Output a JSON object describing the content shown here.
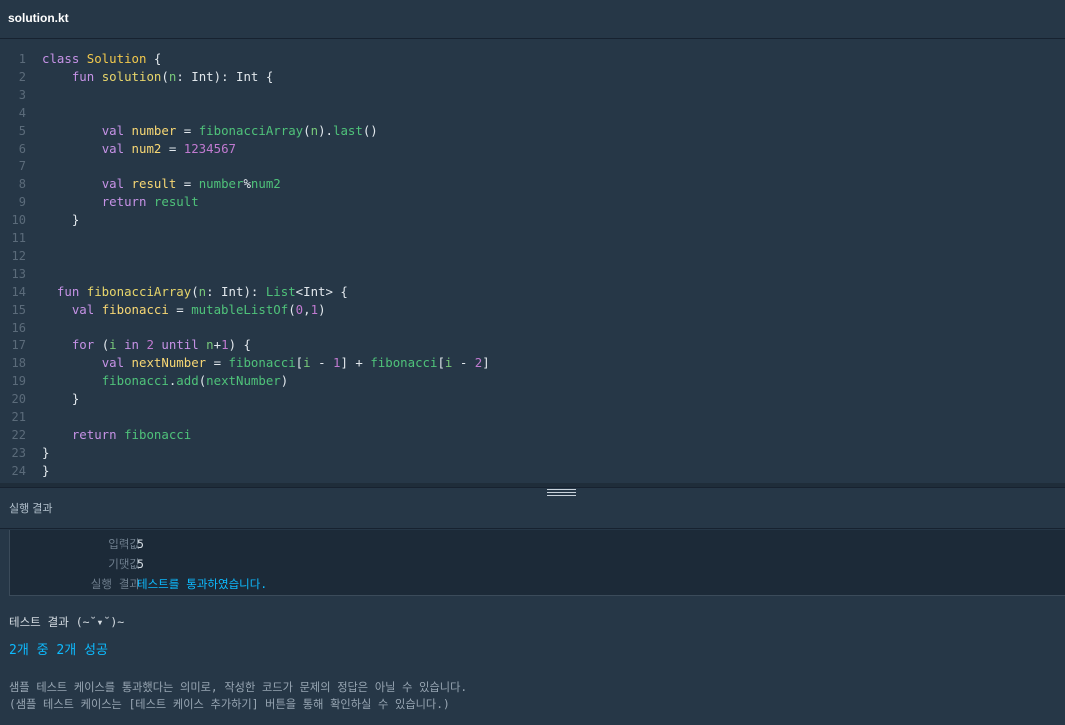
{
  "file": {
    "name": "solution.kt"
  },
  "editor": {
    "lines": [
      {
        "no": "1",
        "tokens": [
          [
            "kw",
            "class "
          ],
          [
            "cls",
            "Solution"
          ],
          [
            "plain",
            " {"
          ]
        ]
      },
      {
        "no": "2",
        "tokens": [
          [
            "plain",
            "    "
          ],
          [
            "kw",
            "fun "
          ],
          [
            "fn",
            "solution"
          ],
          [
            "plain",
            "("
          ],
          [
            "param",
            "n"
          ],
          [
            "plain",
            ": Int): Int {"
          ]
        ]
      },
      {
        "no": "3",
        "tokens": []
      },
      {
        "no": "4",
        "tokens": []
      },
      {
        "no": "5",
        "tokens": [
          [
            "plain",
            "        "
          ],
          [
            "kw",
            "val "
          ],
          [
            "var",
            "number"
          ],
          [
            "plain",
            " = "
          ],
          [
            "call",
            "fibonacciArray"
          ],
          [
            "plain",
            "("
          ],
          [
            "param",
            "n"
          ],
          [
            "plain",
            ")."
          ],
          [
            "call",
            "last"
          ],
          [
            "plain",
            "()"
          ]
        ]
      },
      {
        "no": "6",
        "tokens": [
          [
            "plain",
            "        "
          ],
          [
            "kw",
            "val "
          ],
          [
            "var",
            "num2"
          ],
          [
            "plain",
            " = "
          ],
          [
            "num",
            "1234567"
          ]
        ]
      },
      {
        "no": "7",
        "tokens": []
      },
      {
        "no": "8",
        "tokens": [
          [
            "plain",
            "        "
          ],
          [
            "kw",
            "val "
          ],
          [
            "var",
            "result"
          ],
          [
            "plain",
            " = "
          ],
          [
            "call",
            "number"
          ],
          [
            "plain",
            "%"
          ],
          [
            "call",
            "num2"
          ]
        ]
      },
      {
        "no": "9",
        "tokens": [
          [
            "plain",
            "        "
          ],
          [
            "kw",
            "return "
          ],
          [
            "call",
            "result"
          ]
        ]
      },
      {
        "no": "10",
        "tokens": [
          [
            "plain",
            "    }"
          ]
        ]
      },
      {
        "no": "11",
        "tokens": []
      },
      {
        "no": "12",
        "tokens": []
      },
      {
        "no": "13",
        "tokens": []
      },
      {
        "no": "14",
        "tokens": [
          [
            "plain",
            "  "
          ],
          [
            "kw",
            "fun "
          ],
          [
            "fn",
            "fibonacciArray"
          ],
          [
            "plain",
            "("
          ],
          [
            "param",
            "n"
          ],
          [
            "plain",
            ": Int): "
          ],
          [
            "gtype",
            "List"
          ],
          [
            "plain",
            "<Int> {"
          ]
        ]
      },
      {
        "no": "15",
        "tokens": [
          [
            "plain",
            "    "
          ],
          [
            "kw",
            "val "
          ],
          [
            "var",
            "fibonacci"
          ],
          [
            "plain",
            " = "
          ],
          [
            "call",
            "mutableListOf"
          ],
          [
            "plain",
            "("
          ],
          [
            "num",
            "0"
          ],
          [
            "plain",
            ","
          ],
          [
            "num",
            "1"
          ],
          [
            "plain",
            ")"
          ]
        ]
      },
      {
        "no": "16",
        "tokens": []
      },
      {
        "no": "17",
        "tokens": [
          [
            "plain",
            "    "
          ],
          [
            "kw",
            "for "
          ],
          [
            "plain",
            "("
          ],
          [
            "param",
            "i"
          ],
          [
            "kw",
            " in "
          ],
          [
            "num",
            "2"
          ],
          [
            "kw",
            " until "
          ],
          [
            "param",
            "n"
          ],
          [
            "plain",
            "+"
          ],
          [
            "num",
            "1"
          ],
          [
            "plain",
            ") {"
          ]
        ]
      },
      {
        "no": "18",
        "tokens": [
          [
            "plain",
            "        "
          ],
          [
            "kw",
            "val "
          ],
          [
            "var",
            "nextNumber"
          ],
          [
            "plain",
            " = "
          ],
          [
            "call",
            "fibonacci"
          ],
          [
            "plain",
            "["
          ],
          [
            "param",
            "i"
          ],
          [
            "plain",
            " - "
          ],
          [
            "num",
            "1"
          ],
          [
            "plain",
            "] + "
          ],
          [
            "call",
            "fibonacci"
          ],
          [
            "plain",
            "["
          ],
          [
            "param",
            "i"
          ],
          [
            "plain",
            " - "
          ],
          [
            "num",
            "2"
          ],
          [
            "plain",
            "]"
          ]
        ]
      },
      {
        "no": "19",
        "tokens": [
          [
            "plain",
            "        "
          ],
          [
            "call",
            "fibonacci"
          ],
          [
            "plain",
            "."
          ],
          [
            "call",
            "add"
          ],
          [
            "plain",
            "("
          ],
          [
            "call",
            "nextNumber"
          ],
          [
            "plain",
            ")"
          ]
        ]
      },
      {
        "no": "20",
        "tokens": [
          [
            "plain",
            "    }"
          ]
        ]
      },
      {
        "no": "21",
        "tokens": []
      },
      {
        "no": "22",
        "tokens": [
          [
            "plain",
            "    "
          ],
          [
            "kw",
            "return "
          ],
          [
            "call",
            "fibonacci"
          ]
        ]
      },
      {
        "no": "23",
        "tokens": [
          [
            "plain",
            "}"
          ]
        ]
      },
      {
        "no": "24",
        "tokens": [
          [
            "plain",
            "}"
          ]
        ]
      }
    ]
  },
  "results": {
    "title": "실행 결과",
    "rows": [
      {
        "key": "입력값",
        "sep": "〉",
        "value": "5",
        "pass": false
      },
      {
        "key": "기댓값",
        "sep": "〉",
        "value": "5",
        "pass": false
      },
      {
        "key": "실행 결과",
        "sep": "〉",
        "value": "테스트를 통과하였습니다.",
        "pass": true
      }
    ]
  },
  "summary": {
    "title": "테스트 결과 (~˘▾˘)~",
    "count": "2개 중 2개 성공",
    "note1": "샘플 테스트 케이스를 통과했다는 의미로, 작성한 코드가 문제의 정답은 아닐 수 있습니다.",
    "note2": "(샘플 테스트 케이스는 [테스트 케이스 추가하기] 버튼을 통해 확인하실 수 있습니다.)"
  }
}
